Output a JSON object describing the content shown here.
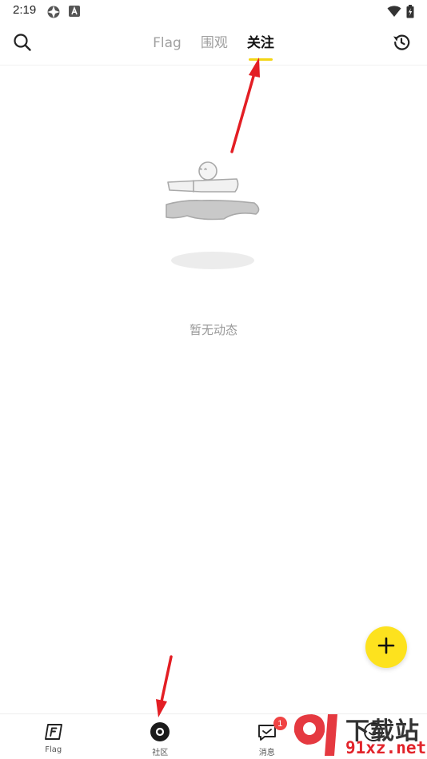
{
  "status": {
    "time": "2:19"
  },
  "tabs": [
    {
      "label": "Flag",
      "active": false
    },
    {
      "label": "围观",
      "active": false
    },
    {
      "label": "关注",
      "active": true
    }
  ],
  "empty_state": {
    "text": "暂无动态"
  },
  "bottom_nav": [
    {
      "label": "Flag",
      "icon": "flag-icon"
    },
    {
      "label": "社区",
      "icon": "community-icon"
    },
    {
      "label": "消息",
      "icon": "message-icon",
      "badge": "1"
    },
    {
      "label": "",
      "icon": "profile-icon"
    }
  ],
  "watermark": {
    "brand": "下载站",
    "site": "91xz.net"
  },
  "colors": {
    "accent": "#fde21e",
    "tab_underline": "#f3d514",
    "badge": "#f04343",
    "annotation": "#e31e24"
  }
}
